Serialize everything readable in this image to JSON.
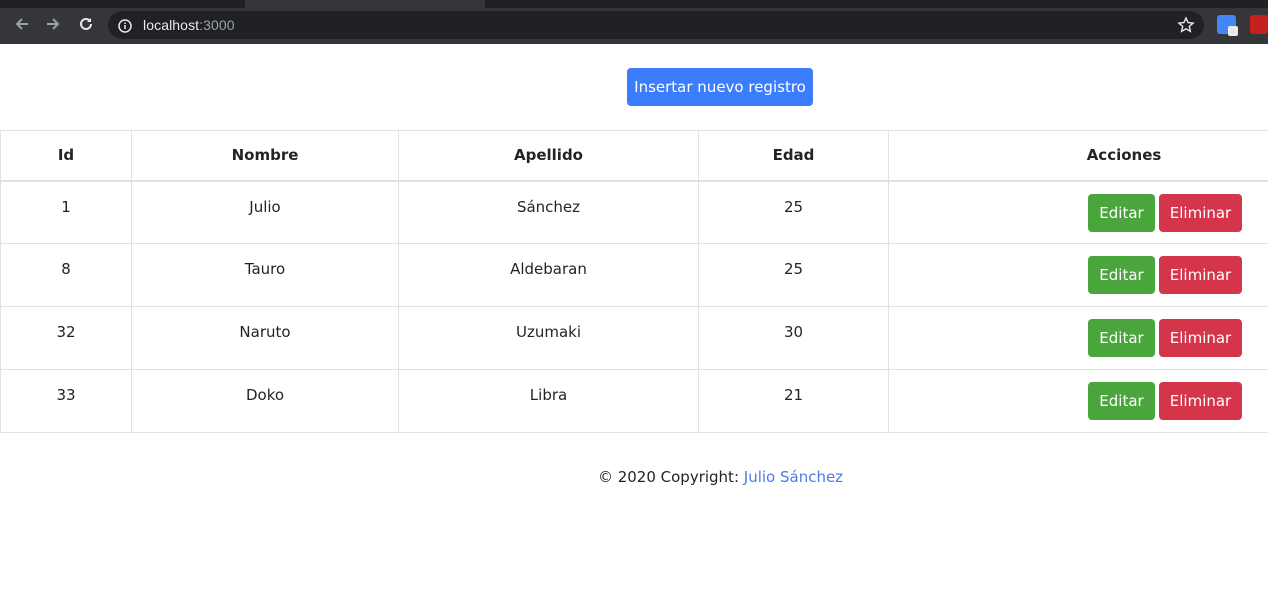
{
  "browser": {
    "url_host": "localhost",
    "url_port": ":3000"
  },
  "page": {
    "insert_button_label": "Insertar nuevo registro",
    "table": {
      "headers": {
        "id": "Id",
        "nombre": "Nombre",
        "apellido": "Apellido",
        "edad": "Edad",
        "acciones": "Acciones"
      },
      "rows": [
        {
          "id": "1",
          "nombre": "Julio",
          "apellido": "Sánchez",
          "edad": "25"
        },
        {
          "id": "8",
          "nombre": "Tauro",
          "apellido": "Aldebaran",
          "edad": "25"
        },
        {
          "id": "32",
          "nombre": "Naruto",
          "apellido": "Uzumaki",
          "edad": "30"
        },
        {
          "id": "33",
          "nombre": "Doko",
          "apellido": "Libra",
          "edad": "21"
        }
      ],
      "edit_label": "Editar",
      "delete_label": "Eliminar"
    },
    "footer": {
      "copyright": "© 2020 Copyright: ",
      "author_link": "Julio Sánchez"
    }
  },
  "colors": {
    "primary": "#3b7dfc",
    "success": "#4aa63c",
    "danger": "#d5354a",
    "link": "#4a7ce8"
  }
}
